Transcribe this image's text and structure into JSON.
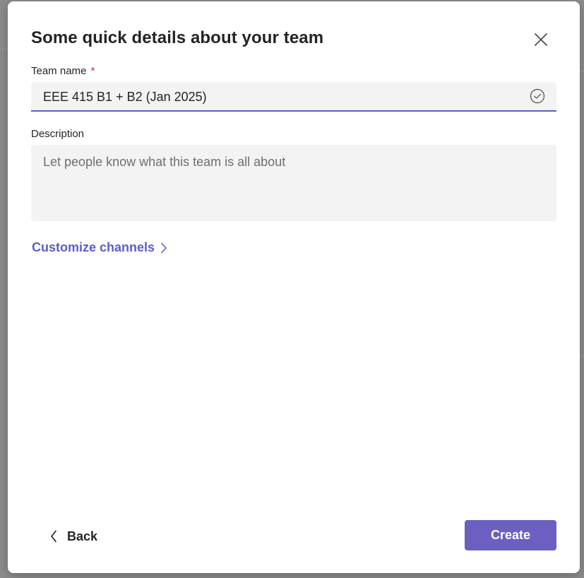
{
  "dialog": {
    "title": "Some quick details about your team",
    "close_icon": "close-icon"
  },
  "team_name": {
    "label": "Team name",
    "required_marker": "*",
    "value": "EEE 415 B1 + B2 (Jan 2025)",
    "status_icon": "check-circle-icon"
  },
  "description": {
    "label": "Description",
    "placeholder": "Let people know what this team is all about",
    "value": ""
  },
  "customize": {
    "label": "Customize channels",
    "icon": "chevron-right-icon"
  },
  "footer": {
    "back_label": "Back",
    "back_icon": "chevron-left-icon",
    "create_label": "Create"
  },
  "colors": {
    "accent": "#5b5fc7",
    "primary_button": "#6b5fc2",
    "required": "#c4314b",
    "field_bg": "#f3f3f3",
    "overlay": "#8c8c8c"
  }
}
